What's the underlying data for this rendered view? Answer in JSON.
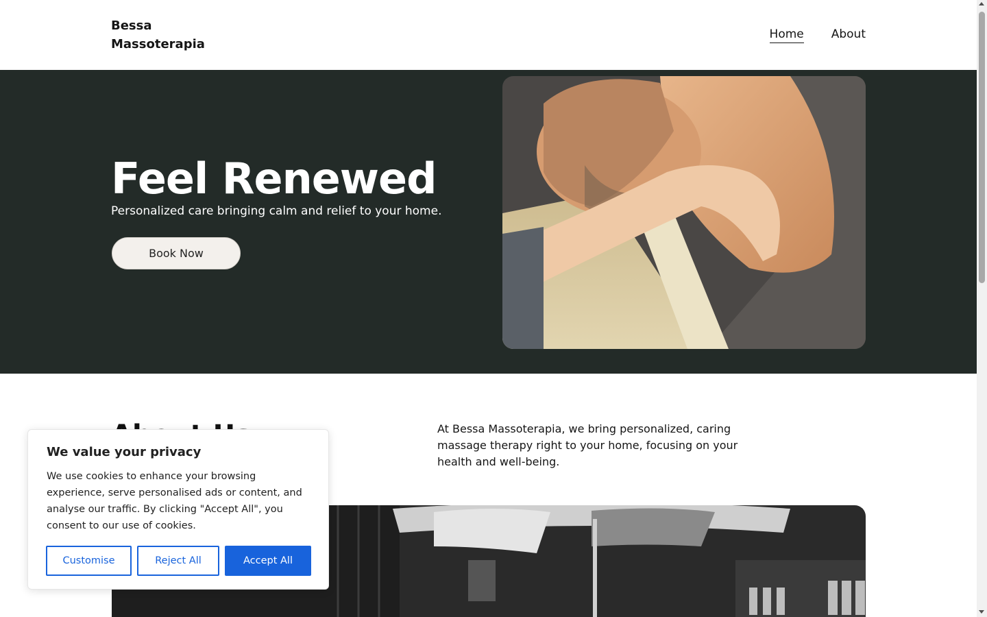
{
  "header": {
    "logo": "Bessa Massoterapia",
    "nav": [
      {
        "label": "Home",
        "active": true
      },
      {
        "label": "About",
        "active": false
      }
    ]
  },
  "hero": {
    "title": "Feel Renewed",
    "subtitle": "Personalized care bringing calm and relief to your home.",
    "cta_label": "Book Now",
    "background_color": "#232b28"
  },
  "about": {
    "title": "About Us",
    "text": "At Bessa Massoterapia, we bring personalized, caring massage therapy right to your home, focusing on your health and well-being."
  },
  "cookie_banner": {
    "title": "We value your privacy",
    "text": "We use cookies to enhance your browsing experience, serve personalised ads or content, and analyse our traffic. By clicking \"Accept All\", you consent to our use of cookies.",
    "buttons": {
      "customise": "Customise",
      "reject": "Reject All",
      "accept": "Accept All"
    },
    "accent_color": "#1863dc"
  }
}
